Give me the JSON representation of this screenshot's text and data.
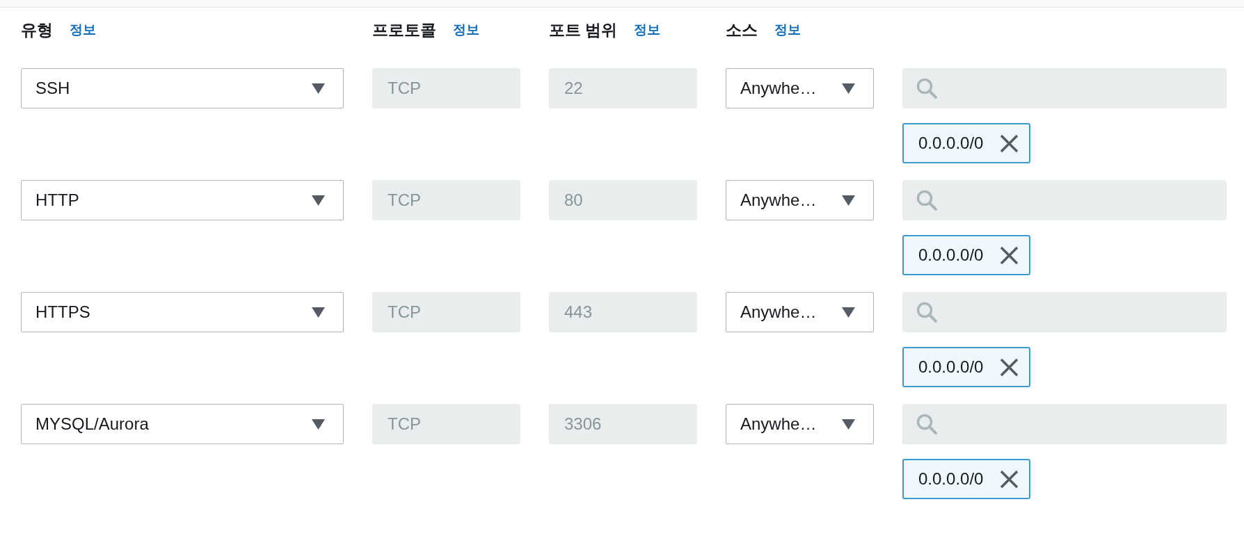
{
  "headers": [
    {
      "label": "유형",
      "info_link": "정보"
    },
    {
      "label": "프로토콜",
      "info_link": "정보"
    },
    {
      "label": "포트 범위",
      "info_link": "정보"
    },
    {
      "label": "소스",
      "info_link": "정보"
    }
  ],
  "rules": [
    {
      "type": "SSH",
      "protocol": {
        "value": "TCP",
        "disabled": true
      },
      "port_range": {
        "value": "22",
        "disabled": true
      },
      "source": "Anywhe…",
      "source_tags": [
        {
          "label": "0.0.0.0/0"
        }
      ]
    },
    {
      "type": "HTTP",
      "protocol": {
        "value": "TCP",
        "disabled": true
      },
      "port_range": {
        "value": "80",
        "disabled": true
      },
      "source": "Anywhe…",
      "source_tags": [
        {
          "label": "0.0.0.0/0"
        }
      ]
    },
    {
      "type": "HTTPS",
      "protocol": {
        "value": "TCP",
        "disabled": true
      },
      "port_range": {
        "value": "443",
        "disabled": true
      },
      "source": "Anywhe…",
      "source_tags": [
        {
          "label": "0.0.0.0/0"
        }
      ]
    },
    {
      "type": "MYSQL/Aurora",
      "protocol": {
        "value": "TCP",
        "disabled": true
      },
      "port_range": {
        "value": "3306",
        "disabled": true
      },
      "source": "Anywhe…",
      "source_tags": [
        {
          "label": "0.0.0.0/0"
        }
      ]
    }
  ]
}
